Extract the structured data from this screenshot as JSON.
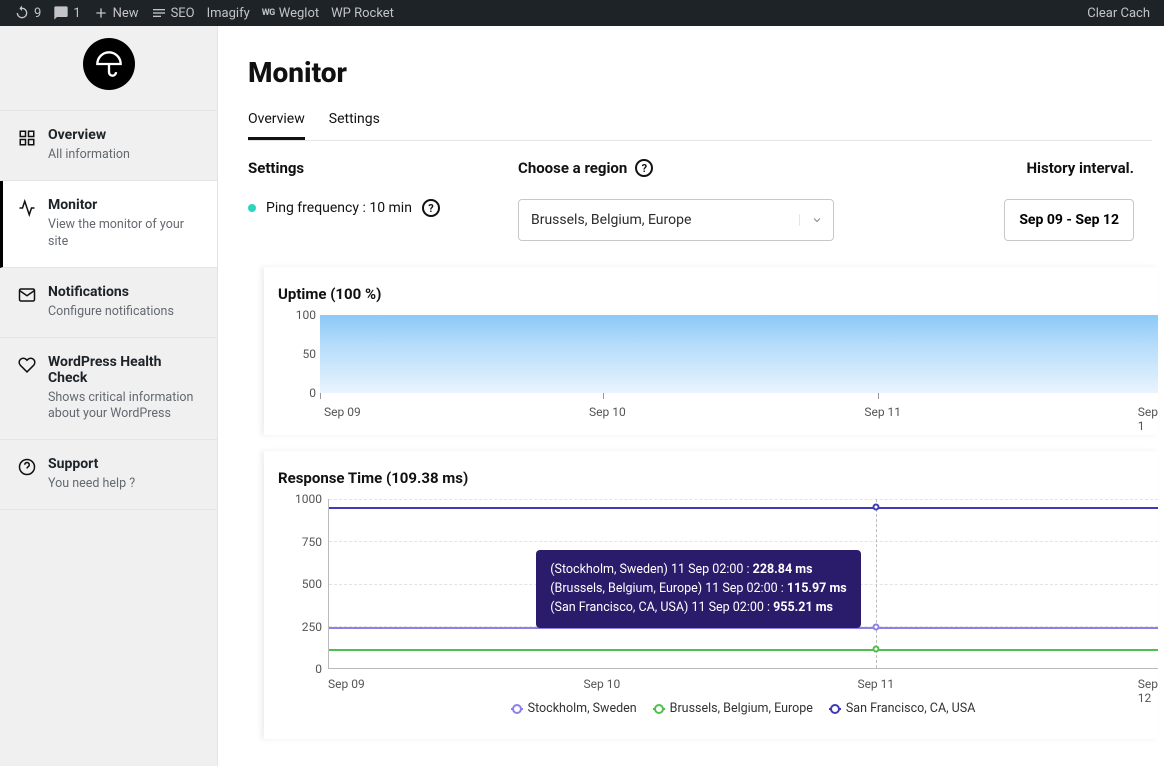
{
  "adminbar": {
    "updates": "9",
    "comments": "1",
    "new": "New",
    "seo": "SEO",
    "imagify": "Imagify",
    "weglot": "Weglot",
    "wprocket": "WP Rocket",
    "clear_cache": "Clear Cach"
  },
  "sidebar": {
    "items": [
      {
        "title": "Overview",
        "sub": "All information"
      },
      {
        "title": "Monitor",
        "sub": "View the monitor of your site"
      },
      {
        "title": "Notifications",
        "sub": "Configure notifications"
      },
      {
        "title": "WordPress Health Check",
        "sub": "Shows critical information about your WordPress"
      },
      {
        "title": "Support",
        "sub": "You need help ?"
      }
    ]
  },
  "page": {
    "title": "Monitor",
    "tabs": [
      "Overview",
      "Settings"
    ],
    "settings_label": "Settings",
    "ping_label": "Ping frequency : 10 min",
    "region_label": "Choose a region",
    "region_value": "Brussels, Belgium, Europe",
    "interval_label": "History interval.",
    "interval_value": "Sep 09 - Sep 12"
  },
  "chart_data": [
    {
      "type": "area",
      "title": "Uptime (100 %)",
      "categories": [
        "Sep 09",
        "Sep 10",
        "Sep 11",
        "Sep 1"
      ],
      "values": [
        100,
        100,
        100,
        100
      ],
      "yticks": [
        0,
        50,
        100
      ],
      "ylim": [
        0,
        100
      ]
    },
    {
      "type": "line",
      "title": "Response Time (109.38 ms)",
      "x": [
        "Sep 09",
        "Sep 10",
        "Sep 11",
        "Sep 12"
      ],
      "yticks": [
        0,
        250,
        500,
        750,
        1000
      ],
      "ylim": [
        0,
        1000
      ],
      "series": [
        {
          "name": "Stockholm, Sweden",
          "color": "#8d80e6",
          "values": [
            235,
            235,
            228.84,
            250
          ]
        },
        {
          "name": "Brussels, Belgium, Europe",
          "color": "#4fbf4f",
          "values": [
            95,
            100,
            115.97,
            120
          ]
        },
        {
          "name": "San Francisco, CA, USA",
          "color": "#3e3ab8",
          "values": [
            955,
            955,
            955.21,
            955
          ]
        }
      ],
      "tooltip": {
        "lines": [
          {
            "label": "(Stockholm, Sweden) 11 Sep 02:00 : ",
            "value": "228.84 ms"
          },
          {
            "label": "(Brussels, Belgium, Europe) 11 Sep 02:00 : ",
            "value": "115.97 ms"
          },
          {
            "label": "(San Francisco, CA, USA) 11 Sep 02:00 : ",
            "value": "955.21 ms"
          }
        ]
      }
    }
  ]
}
